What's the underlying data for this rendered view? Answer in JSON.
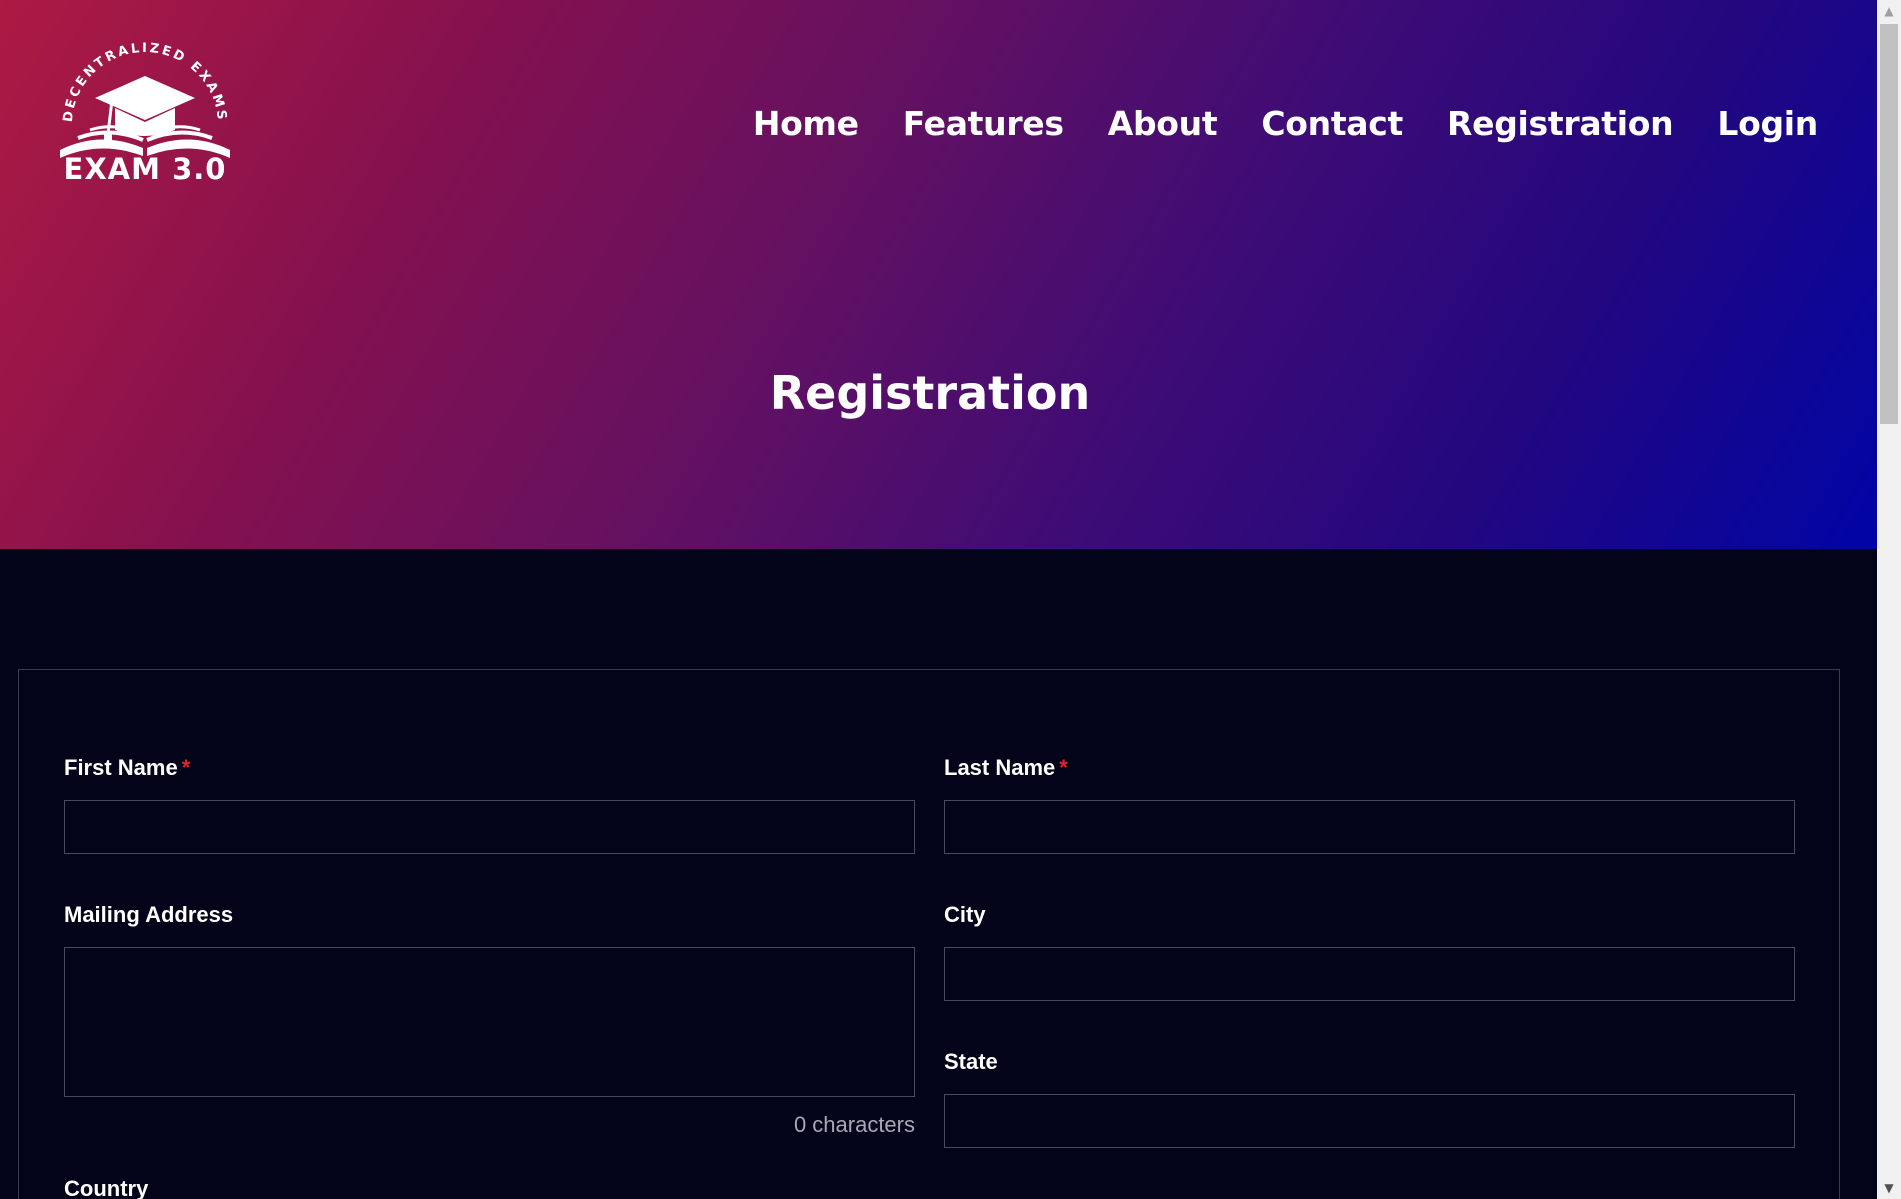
{
  "brand": {
    "arc_text": "DECENTRALIZED EXAMS",
    "name": "EXAM 3.0"
  },
  "nav": {
    "home": "Home",
    "features": "Features",
    "about": "About",
    "contact": "Contact",
    "registration": "Registration",
    "login": "Login"
  },
  "hero": {
    "title": "Registration"
  },
  "form": {
    "first_name": {
      "label": "First Name",
      "required_mark": "*",
      "value": ""
    },
    "last_name": {
      "label": "Last Name",
      "required_mark": "*",
      "value": ""
    },
    "mailing_address": {
      "label": "Mailing Address",
      "value": "",
      "char_count": "0 characters"
    },
    "city": {
      "label": "City",
      "value": ""
    },
    "state": {
      "label": "State",
      "value": ""
    },
    "country": {
      "label": "Country"
    }
  },
  "colors": {
    "hero_gradient_start": "#ad1a43",
    "hero_gradient_mid": "#661160",
    "hero_gradient_end": "#0005a6",
    "page_background": "#03031a",
    "required_mark": "#e0242f"
  },
  "scrollbar": {
    "up_icon": "▲",
    "down_icon": "▼"
  }
}
